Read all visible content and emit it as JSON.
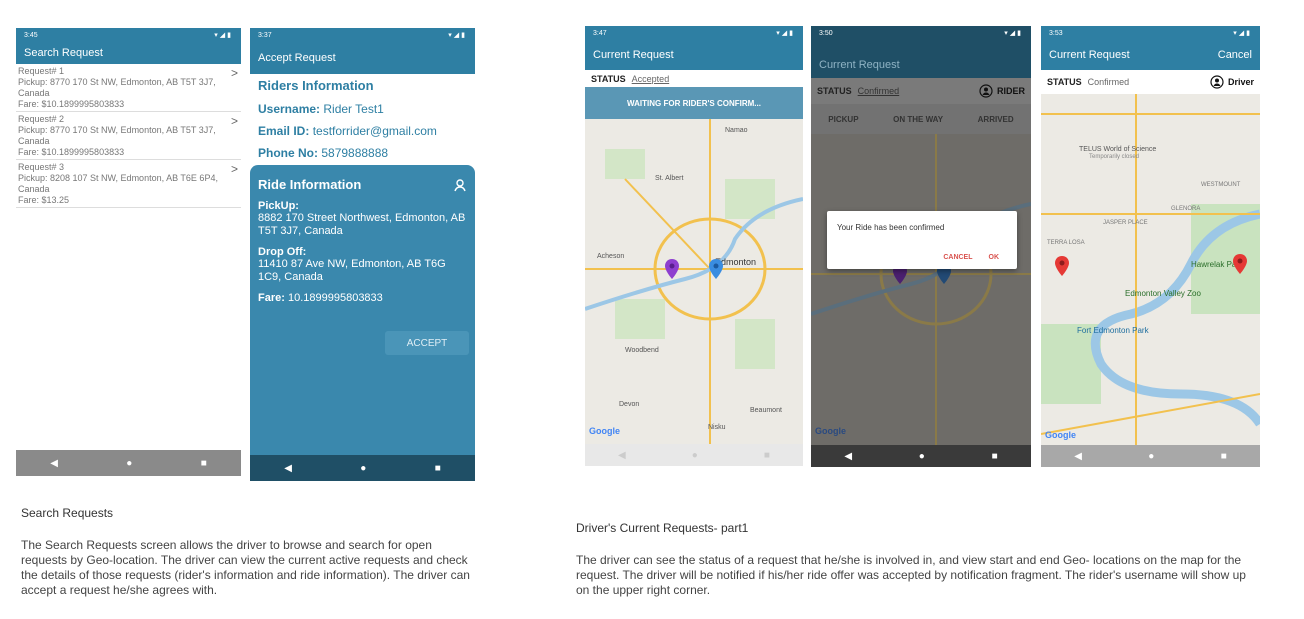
{
  "screen1": {
    "time": "3:45",
    "title": "Search Request",
    "requests": [
      {
        "id": "Request# 1",
        "pickup": "Pickup: 8770 170 St NW, Edmonton, AB T5T 3J7, Canada",
        "fare": "Fare: $10.1899995803833"
      },
      {
        "id": "Request# 2",
        "pickup": "Pickup: 8770 170 St NW, Edmonton, AB T5T 3J7, Canada",
        "fare": "Fare: $10.1899995803833"
      },
      {
        "id": "Request# 3",
        "pickup": "Pickup: 8208 107 St NW, Edmonton, AB T6E 6P4, Canada",
        "fare": "Fare: $13.25"
      }
    ],
    "arrow": ">"
  },
  "screen2": {
    "time": "3:37",
    "title": "Accept Request",
    "riders_heading": "Riders Information",
    "username_label": "Username:",
    "username": "Rider Test1",
    "email_label": "Email ID:",
    "email": "testforrider@gmail.com",
    "phone_label": "Phone No:",
    "phone": "5879888888",
    "ride_heading": "Ride Information",
    "pickup_label": "PickUp:",
    "pickup": "8882 170 Street Northwest, Edmonton, AB T5T 3J7, Canada",
    "dropoff_label": "Drop Off:",
    "dropoff": "11410 87 Ave NW, Edmonton, AB T6G 1C9, Canada",
    "fare_label": "Fare:",
    "fare": "10.1899995803833",
    "accept": "ACCEPT"
  },
  "screen3": {
    "time": "3:47",
    "title": "Current Request",
    "status_label": "STATUS",
    "status": "Accepted",
    "banner": "WAITING FOR RIDER'S CONFIRM...",
    "map_labels": [
      "Namao",
      "St. Albert",
      "Acheson",
      "Edmonton",
      "Woodbend",
      "Devon",
      "Beaumont",
      "Nisku"
    ],
    "google": "Google"
  },
  "screen4": {
    "time": "3:50",
    "title": "Current Request",
    "status_label": "STATUS",
    "status": "Confirmed",
    "role": "RIDER",
    "steps": [
      "PICKUP",
      "ON THE WAY",
      "ARRIVED"
    ],
    "dialog_text": "Your Ride has been confirmed",
    "cancel": "CANCEL",
    "ok": "OK",
    "google": "Google"
  },
  "screen5": {
    "time": "3:53",
    "title": "Current Request",
    "cancel": "Cancel",
    "status_label": "STATUS",
    "status": "Confirmed",
    "role": "Driver",
    "map_labels": [
      "TELUS World of Science",
      "Temporarily closed",
      "Hawrelak Park",
      "Edmonton Valley Zoo",
      "Fort Edmonton Park",
      "JASPER PLACE",
      "GLENORA",
      "WESTMOUNT",
      "TERRA LOSA"
    ],
    "google": "Google"
  },
  "captions": {
    "left_title": "Search Requests",
    "left_body": "The Search Requests screen allows the driver to browse and search for open requests by Geo-location. The driver can view the current active requests and check the details of those requests (rider's information and ride information). The driver can accept a request he/she agrees with.",
    "right_title": "Driver's Current Requests- part1",
    "right_body": "The driver can see the status of a request that he/she is involved in, and view start and end Geo- locations on the map for the request. The driver will be notified if his/her ride offer was accepted by notification fragment. The rider's username will show up on the upper right corner."
  },
  "nav": {
    "back": "◀",
    "home": "●",
    "recents": "■"
  },
  "colors": {
    "primary": "#2e7fa3",
    "panel": "#3a88ad",
    "navbar": "#1f4f66"
  }
}
